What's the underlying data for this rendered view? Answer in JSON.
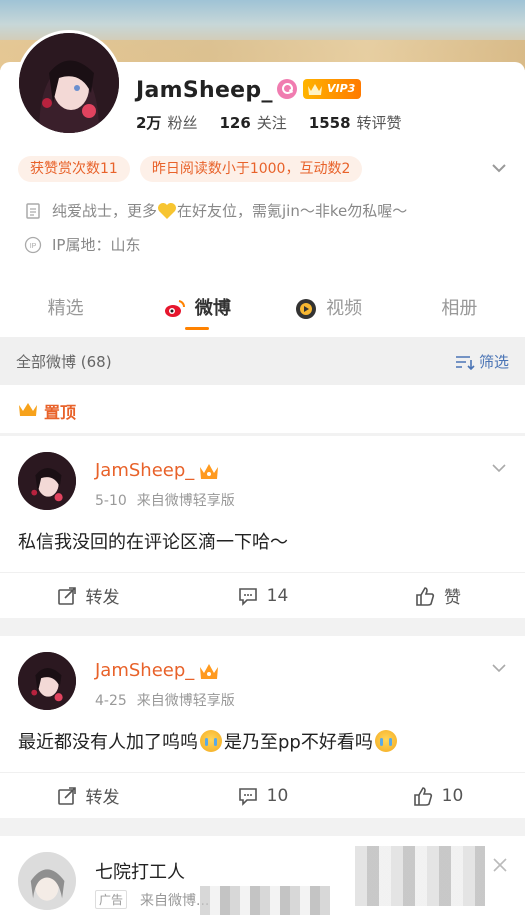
{
  "profile": {
    "username": "JamSheep_",
    "vip_label": "VIP3",
    "stats": [
      {
        "value": "2万",
        "label": "粉丝"
      },
      {
        "value": "126",
        "label": "关注"
      },
      {
        "value": "1558",
        "label": "转评赞"
      }
    ],
    "tags": [
      "获赞赏次数11",
      "昨日阅读数小于1000，互动数2"
    ],
    "bio_before": "纯爱战士，更多",
    "bio_after": "在好友位，需氪jin～非ke勿私喔～",
    "ip": "IP属地：山东"
  },
  "tabs": [
    {
      "label": "精选",
      "active": false
    },
    {
      "label": "微博",
      "active": true
    },
    {
      "label": "视频",
      "active": false
    },
    {
      "label": "相册",
      "active": false
    }
  ],
  "filter": {
    "count_label": "全部微博 (68)",
    "filter_label": "筛选"
  },
  "pinned_label": "置顶",
  "posts": [
    {
      "author": "JamSheep_",
      "date": "5-10",
      "source": "来自微博轻享版",
      "text": "私信我没回的在评论区滴一下哈～",
      "repost_label": "转发",
      "comments": "14",
      "likes": "赞"
    },
    {
      "author": "JamSheep_",
      "date": "4-25",
      "source": "来自微博轻享版",
      "text_part1": "最近都没有人加了呜呜",
      "text_part2": "是乃至pp不好看吗",
      "repost_label": "转发",
      "comments": "10",
      "likes": "10"
    },
    {
      "author": "七院打工人",
      "ad_tag": "广告",
      "source": "来自微博..."
    }
  ],
  "colors": {
    "accent": "#ff8200",
    "orange_text": "#e8622a",
    "link_blue": "#4a74b5"
  }
}
